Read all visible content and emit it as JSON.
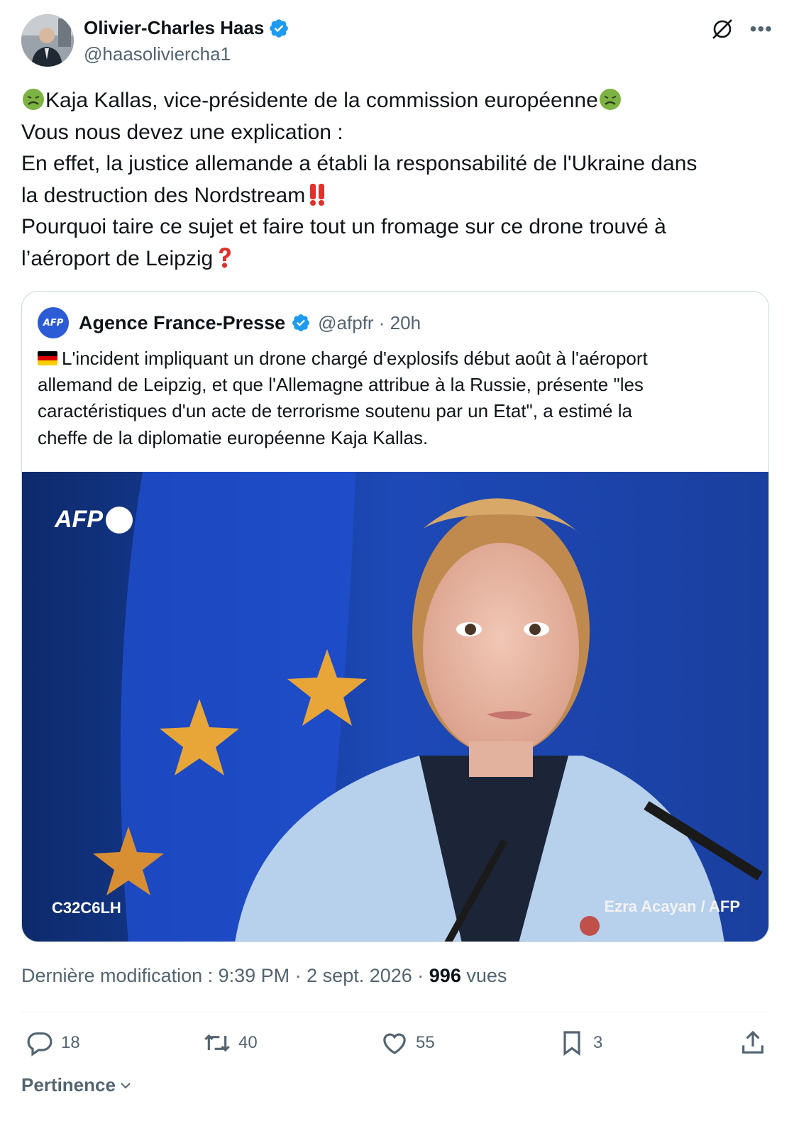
{
  "author": {
    "name": "Olivier-Charles Haas",
    "handle": "@haasoliviercha1",
    "verified": true
  },
  "tweet": {
    "lines": [
      "Kaja Kallas, vice-présidente de la commission européenne",
      "Vous nous devez une explication :",
      "En effet, la justice allemande a  établi la responsabilité de l'Ukraine dans",
      "la destruction des Nordstream",
      "Pourquoi taire ce sujet et faire tout un fromage sur ce drone trouvé à",
      "l’aéroport de Leipzig"
    ],
    "emojis": [
      "nauseated-face",
      "double-exclamation",
      "red-question-mark"
    ]
  },
  "quote": {
    "name": "Agence France-Presse",
    "handle": "@afpfr · 20h",
    "logo_text": "AFP",
    "lines": [
      "L'incident impliquant un drone chargé d'explosifs début août à l'aéroport",
      "allemand de Leipzig, et que l'Allemagne attribue à la Russie, présente \"les",
      "caractéristiques d'un acte de terrorisme soutenu par un Etat\", a estimé la",
      "cheffe de la diplomatie européenne Kaja Kallas."
    ],
    "image": {
      "watermark": "AFP",
      "code": "C32C6LH",
      "credit": "Ezra Acayan / AFP"
    }
  },
  "meta": {
    "prefix": "Dernière modification : 9:39 PM · 2 sept. 2026 · ",
    "views": "996",
    "views_label": " vues"
  },
  "actions": {
    "replies": "18",
    "reposts": "40",
    "likes": "55",
    "bookmarks": "3"
  },
  "sort_label": "Pertinence",
  "colors": {
    "verified": "#1d9bf0",
    "secondary_text": "#536471",
    "border": "#cfd9de"
  }
}
